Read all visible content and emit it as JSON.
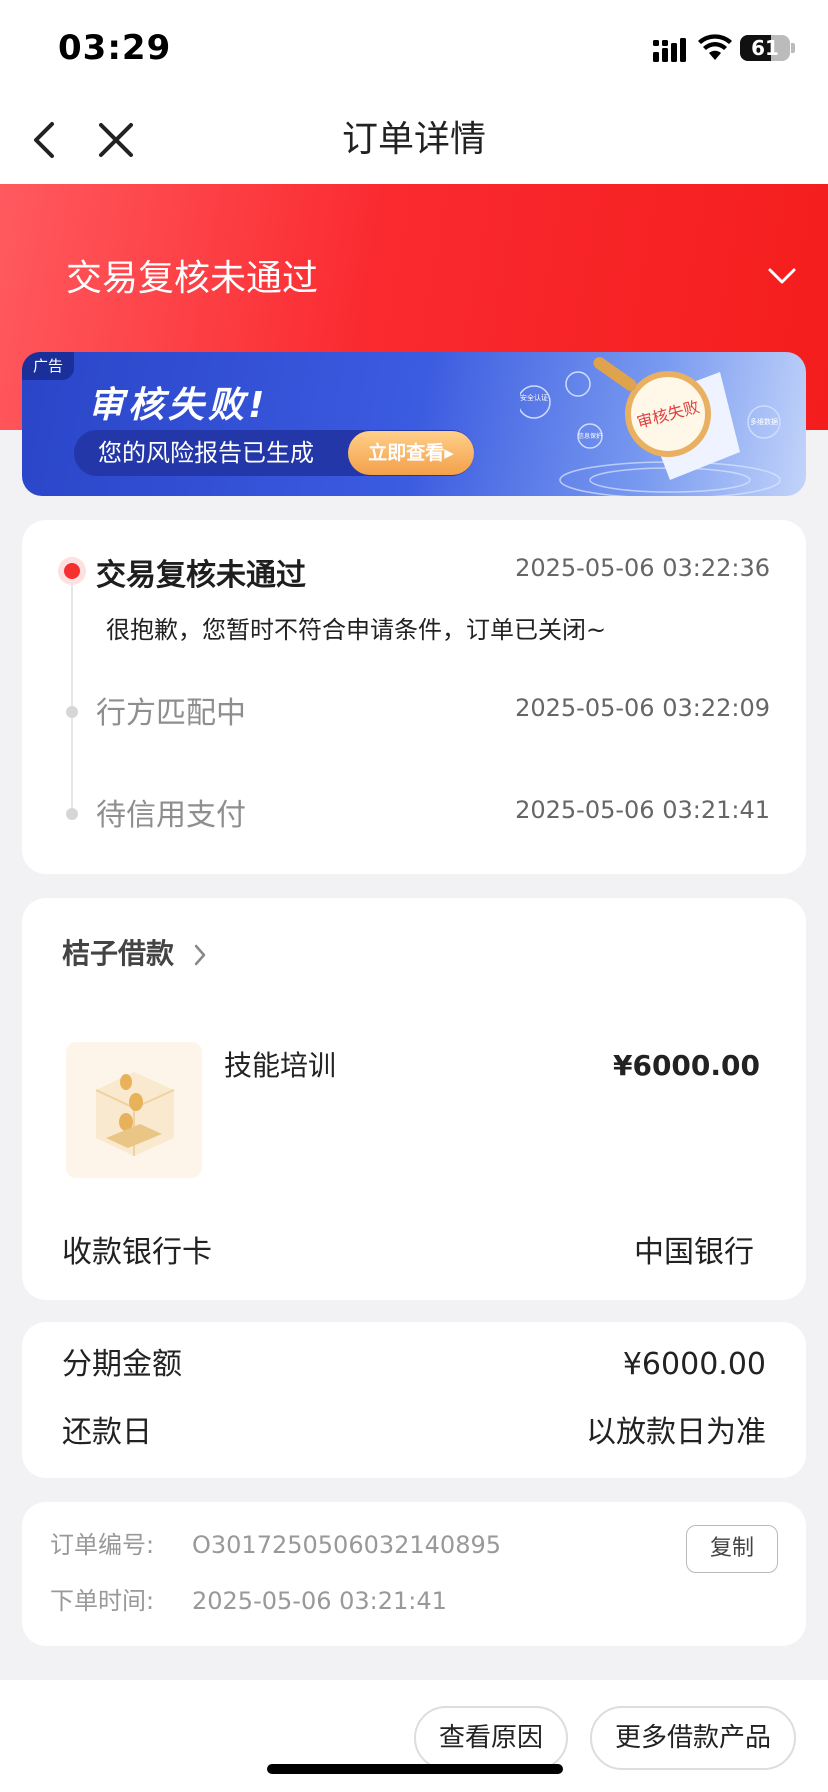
{
  "status_bar": {
    "time": "03:29",
    "battery": "61"
  },
  "nav": {
    "title": "订单详情"
  },
  "header": {
    "status": "交易复核未通过"
  },
  "ad": {
    "tag": "广告",
    "headline": "审核失败!",
    "subtext": "您的风险报告已生成",
    "cta": "立即查看▸",
    "art_labels": [
      "安全认证",
      "信息保护",
      "多维数据",
      "审核失败"
    ]
  },
  "timeline": {
    "steps": [
      {
        "title": "交易复核未通过",
        "time": "2025-05-06 03:22:36",
        "desc": "很抱歉，您暂时不符合申请条件，订单已关闭~",
        "active": true
      },
      {
        "title": "行方匹配中",
        "time": "2025-05-06 03:22:09",
        "active": false
      },
      {
        "title": "待信用支付",
        "time": "2025-05-06 03:21:41",
        "active": false
      }
    ]
  },
  "loan": {
    "lender": "桔子借款",
    "product_name": "技能培训",
    "product_amount": "¥6000.00",
    "bank_label": "收款银行卡",
    "bank_value": "中国银行"
  },
  "installment": {
    "rows": [
      {
        "label": "分期金额",
        "value": "¥6000.00"
      },
      {
        "label": "还款日",
        "value": "以放款日为准"
      }
    ]
  },
  "order": {
    "number_label": "订单编号:",
    "number_value": "O3017250506032140895",
    "time_label": "下单时间:",
    "time_value": "2025-05-06 03:21:41",
    "copy_label": "复制"
  },
  "bottom": {
    "reason_label": "查看原因",
    "more_label": "更多借款产品"
  },
  "colors": {
    "brand_red": "#f41d1d",
    "ad_blue": "#3b5be0",
    "cta_orange": "#f3a04a"
  }
}
